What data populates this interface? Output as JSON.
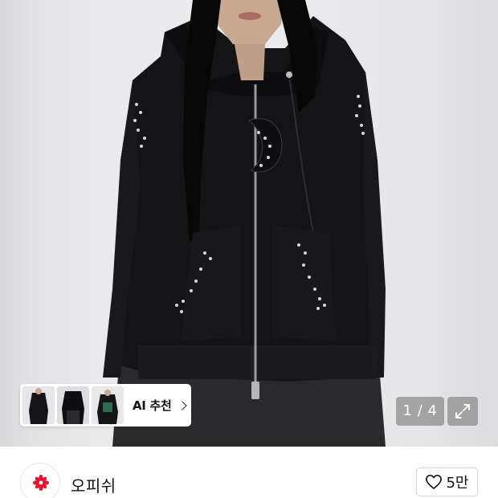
{
  "gallery": {
    "current_page": 1,
    "total_pages": 4,
    "counter_text": "1 / 4",
    "expand_icon": "expand-arrows-icon"
  },
  "thumbnails": {
    "count": 3,
    "ai_label": "AI 추천",
    "chevron_icon": "chevron-right-icon"
  },
  "seller": {
    "name": "오피쉬",
    "logo_icon": "red-flower-logo-icon",
    "logo_color": "#e8112d"
  },
  "like": {
    "icon": "heart-outline-icon",
    "count_label": "5만"
  },
  "colors": {
    "hoodie": "#121214",
    "background": "#ececee",
    "counter_bg": "#6e6e6e"
  }
}
